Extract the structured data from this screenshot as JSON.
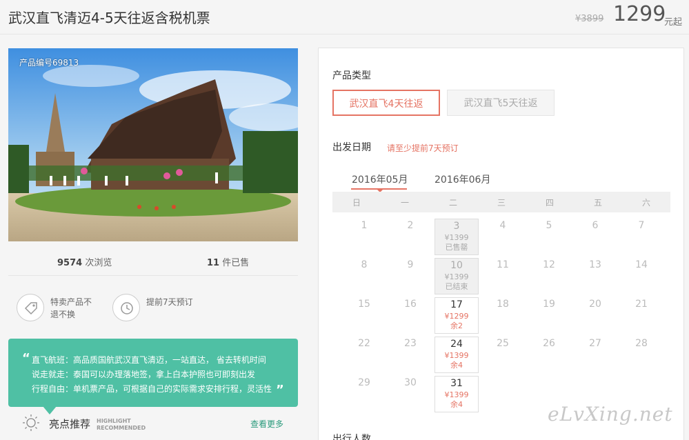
{
  "header": {
    "title": "武汉直飞清迈4-5天往返含税机票",
    "original_price": "¥3899",
    "price": "1299",
    "price_unit": "元起"
  },
  "hero": {
    "product_id": "产品编号69813"
  },
  "stats": {
    "views_count": "9574",
    "views_label": "次浏览",
    "sold_count": "11",
    "sold_label": "件已售"
  },
  "features": [
    {
      "icon": "tag-icon",
      "text": "特卖产品不退不换"
    },
    {
      "icon": "clock-icon",
      "text": "提前7天预订"
    }
  ],
  "highlights": {
    "lines": [
      "直飞航班：高品质国航武汉直飞清迈，一站直达， 省去转机时间",
      "说走就走：泰国可以办理落地签，拿上白本护照也可即刻出发",
      "行程自由：单机票产品，可根据自己的实际需求安排行程，灵活性"
    ],
    "title": "亮点推荐",
    "title_en_1": "HIGHLIGHT",
    "title_en_2": "RECOMMENDED",
    "more": "查看更多"
  },
  "booking": {
    "product_type_label": "产品类型",
    "product_types": [
      {
        "label": "武汉直飞4天往返",
        "selected": true
      },
      {
        "label": "武汉直飞5天往返",
        "selected": false
      }
    ],
    "departure_label": "出发日期",
    "departure_note": "请至少提前7天预订",
    "months": [
      "2016年05月",
      "2016年06月"
    ],
    "active_month": "2016年05月",
    "weekdays": [
      "日",
      "一",
      "二",
      "三",
      "四",
      "五",
      "六"
    ],
    "days": [
      {
        "d": "1"
      },
      {
        "d": "2"
      },
      {
        "d": "3",
        "state": "closed",
        "price": "¥1399",
        "note": "已售罄"
      },
      {
        "d": "4"
      },
      {
        "d": "5"
      },
      {
        "d": "6"
      },
      {
        "d": "7"
      },
      {
        "d": "8"
      },
      {
        "d": "9"
      },
      {
        "d": "10",
        "state": "closed",
        "price": "¥1399",
        "note": "已结束"
      },
      {
        "d": "11"
      },
      {
        "d": "12"
      },
      {
        "d": "13"
      },
      {
        "d": "14"
      },
      {
        "d": "15"
      },
      {
        "d": "16"
      },
      {
        "d": "17",
        "state": "avail",
        "price": "¥1299",
        "note": "余2"
      },
      {
        "d": "18"
      },
      {
        "d": "19"
      },
      {
        "d": "20"
      },
      {
        "d": "21"
      },
      {
        "d": "22"
      },
      {
        "d": "23"
      },
      {
        "d": "24",
        "state": "avail",
        "price": "¥1399",
        "note": "余4"
      },
      {
        "d": "25"
      },
      {
        "d": "26"
      },
      {
        "d": "27"
      },
      {
        "d": "28"
      },
      {
        "d": "29"
      },
      {
        "d": "30"
      },
      {
        "d": "31",
        "state": "avail",
        "price": "¥1399",
        "note": "余4"
      }
    ],
    "travelers_label": "出行人数"
  },
  "watermark": "eLvXing.net",
  "colors": {
    "accent": "#e57363",
    "teal": "#4fc0a4"
  }
}
